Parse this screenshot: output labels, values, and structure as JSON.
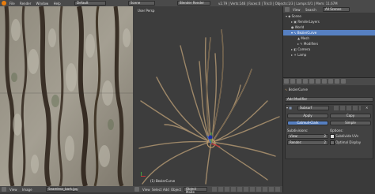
{
  "top": {
    "menu": [
      "File",
      "Render",
      "Window",
      "Help"
    ],
    "screen": "Default",
    "scene": "Scene",
    "engine": "Blender Render",
    "stats": "v2.79 | Verts:146 | Faces:0 | Tris:0 | Objects:1/3 | Lamps:0/1 | Mem: 11.67M"
  },
  "uv_editor": {
    "header": [
      "View",
      "Image"
    ],
    "image_name": "Seamless_bark.jpg"
  },
  "viewport": {
    "label": "User Persp",
    "object_label": "(1) BezierCurve",
    "header": [
      "View",
      "Select",
      "Add",
      "Object"
    ],
    "mode": "Object Mode"
  },
  "outliner": {
    "header_items": [
      "View",
      "Search",
      "All Scenes"
    ],
    "rows": [
      {
        "label": "Scene",
        "indent": 0,
        "sel": false
      },
      {
        "label": "RenderLayers",
        "indent": 1,
        "sel": false
      },
      {
        "label": "World",
        "indent": 1,
        "sel": false
      },
      {
        "label": "BezierCurve",
        "indent": 1,
        "sel": true
      },
      {
        "label": "Mesh",
        "indent": 2,
        "sel": false
      },
      {
        "label": "Modifiers",
        "indent": 2,
        "sel": false
      },
      {
        "label": "Camera",
        "indent": 1,
        "sel": false
      },
      {
        "label": "Lamp",
        "indent": 1,
        "sel": false
      }
    ]
  },
  "properties": {
    "object_name": "BezierCurve",
    "add_modifier": "Add Modifier",
    "modifier_name": "Subsurf",
    "apply": "Apply",
    "copy": "Copy",
    "catmull": "Catmull-Clark",
    "simple": "Simple",
    "subdivisions": "Subdivisions:",
    "options": "Options:",
    "view_label": "View:",
    "view_value": "2",
    "render_label": "Render:",
    "render_value": "2",
    "subdivide_uvs": "Subdivide UVs",
    "optimal_display": "Optimal Display"
  }
}
